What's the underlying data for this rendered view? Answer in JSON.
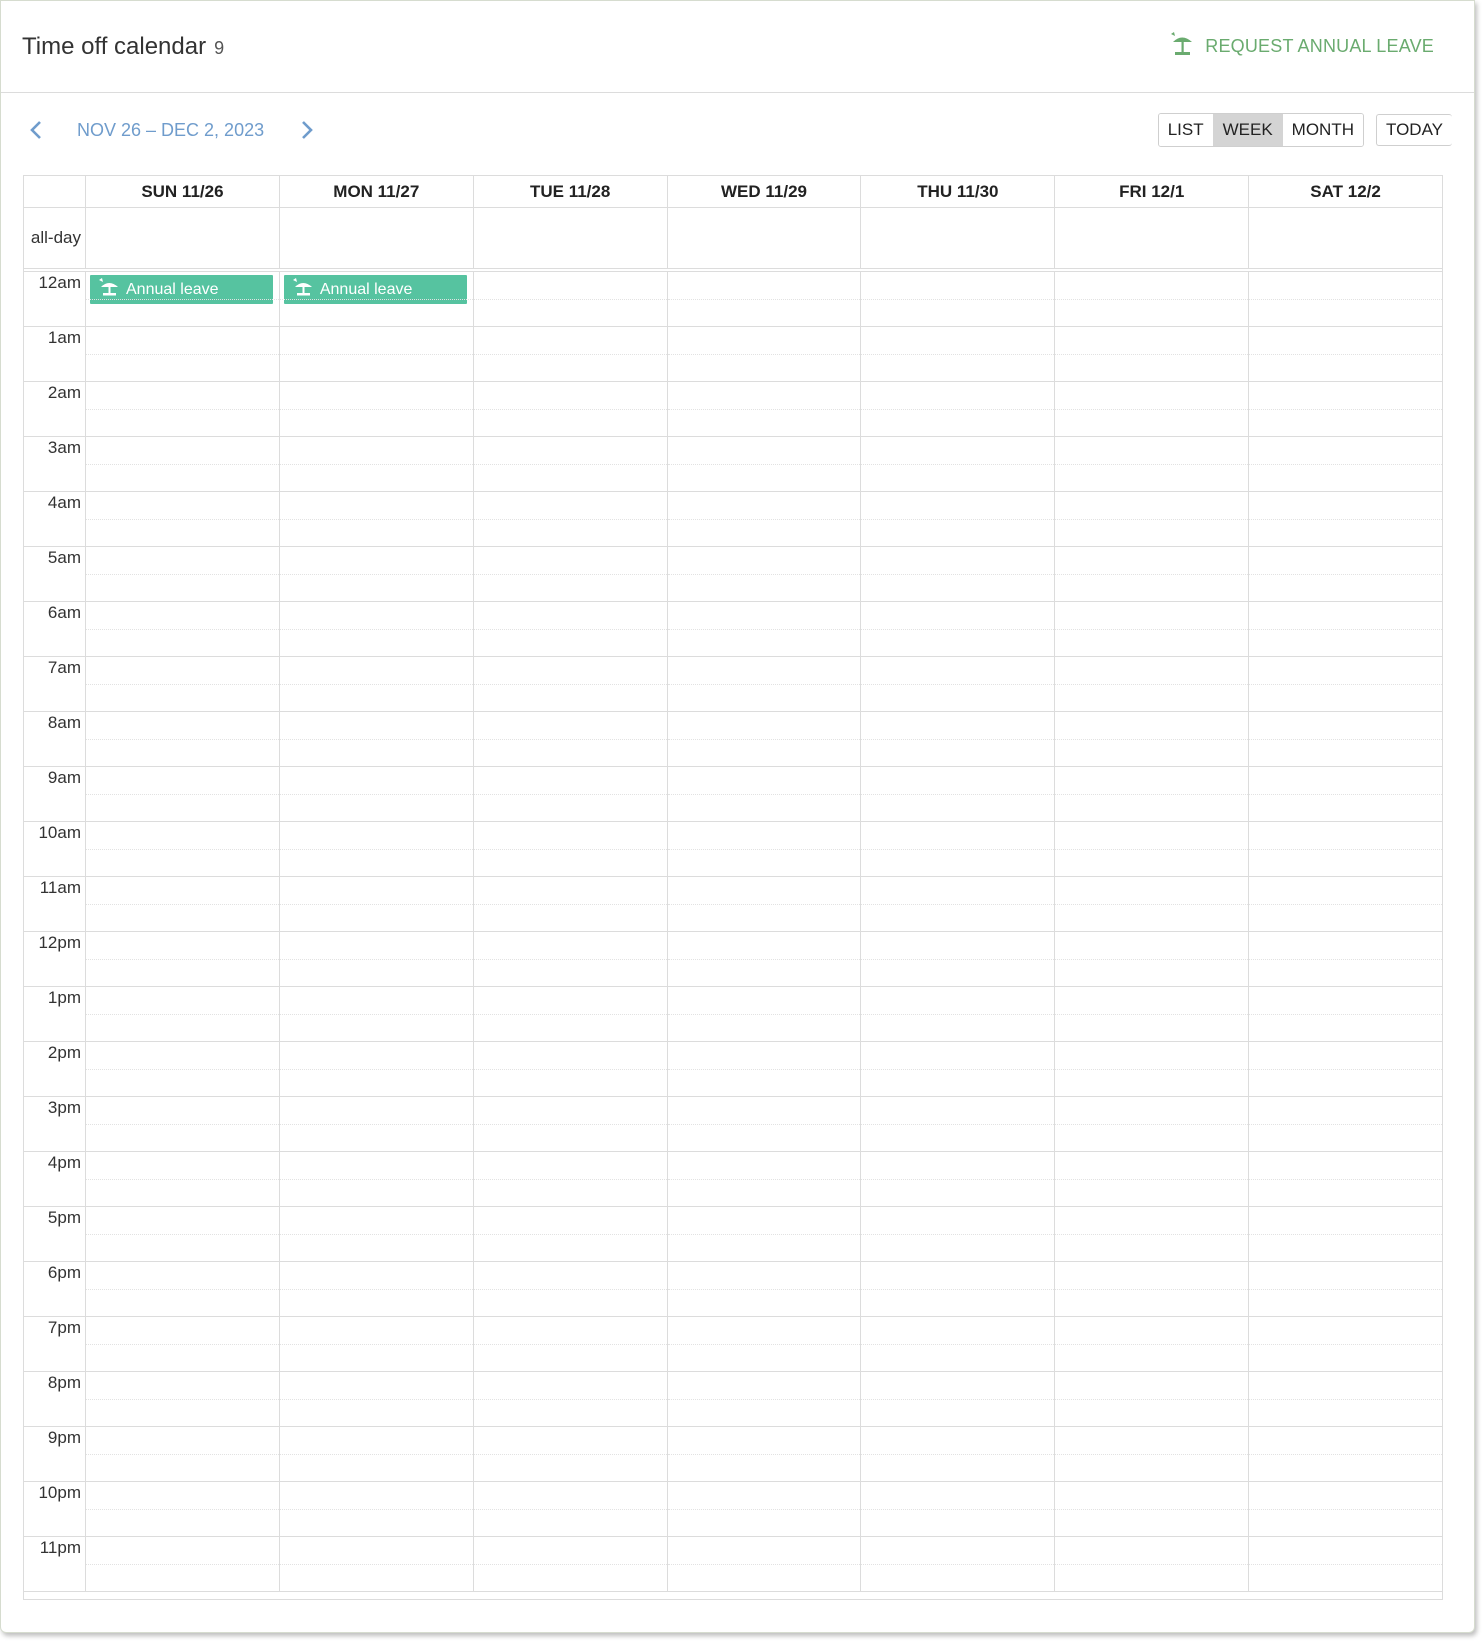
{
  "header": {
    "title": "Time off calendar",
    "count": "9",
    "request_label": "REQUEST ANNUAL LEAVE",
    "request_icon": "beach-umbrella-icon"
  },
  "toolbar": {
    "prev_icon": "chevron-left-icon",
    "next_icon": "chevron-right-icon",
    "date_range": "NOV 26 – DEC 2, 2023",
    "views": [
      "LIST",
      "WEEK",
      "MONTH"
    ],
    "active_view": "WEEK",
    "today_label": "TODAY"
  },
  "calendar": {
    "days": [
      "SUN 11/26",
      "MON 11/27",
      "TUE 11/28",
      "WED 11/29",
      "THU 11/30",
      "FRI 12/1",
      "SAT 12/2"
    ],
    "allday_label": "all-day",
    "hours": [
      "12am",
      "1am",
      "2am",
      "3am",
      "4am",
      "5am",
      "6am",
      "7am",
      "8am",
      "9am",
      "10am",
      "11am",
      "12pm",
      "1pm",
      "2pm",
      "3pm",
      "4pm",
      "5pm",
      "6pm",
      "7pm",
      "8pm",
      "9pm",
      "10pm",
      "11pm"
    ],
    "events": [
      {
        "day_index": 0,
        "hour_index": 0,
        "label": "Annual leave",
        "icon": "beach-umbrella-icon"
      },
      {
        "day_index": 1,
        "hour_index": 0,
        "label": "Annual leave",
        "icon": "beach-umbrella-icon"
      }
    ]
  },
  "colors": {
    "accent_green": "#6aab6f",
    "event_green": "#56c3a0",
    "range_blue": "#6f9ccc"
  }
}
